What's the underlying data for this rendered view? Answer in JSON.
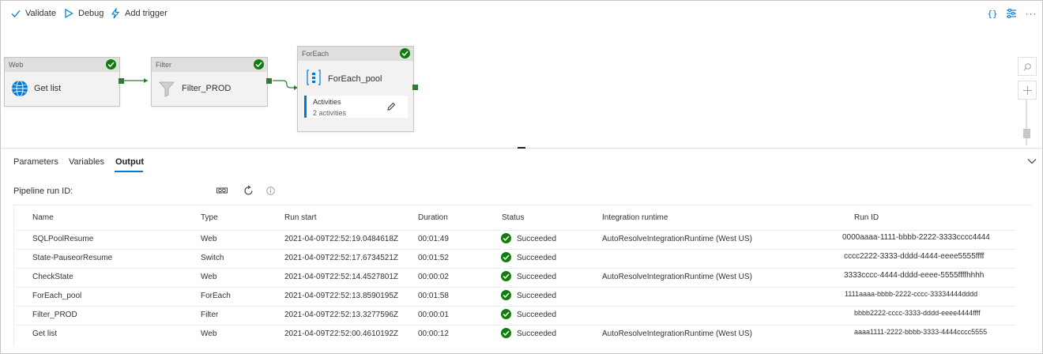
{
  "toolbar": {
    "validate_label": "Validate",
    "debug_label": "Debug",
    "add_trigger_label": "Add trigger",
    "right_icons": [
      "code-braces-icon",
      "properties-icon",
      "more-icon"
    ]
  },
  "canvas": {
    "nodes": [
      {
        "type": "Web",
        "label": "Get list",
        "icon": "globe-icon"
      },
      {
        "type": "Filter",
        "label": "Filter_PROD",
        "icon": "filter-icon"
      },
      {
        "type": "ForEach",
        "label": "ForEach_pool",
        "icon": "foreach-icon",
        "activities_title": "Activities",
        "activities_count": "2 activities"
      }
    ],
    "accent_color": "#0078d4",
    "success_color": "#107c10"
  },
  "tabs": [
    {
      "label": "Parameters"
    },
    {
      "label": "Variables"
    },
    {
      "label": "Output",
      "active": true
    }
  ],
  "output": {
    "run_id_label": "Pipeline run ID:",
    "columns": [
      "Name",
      "Type",
      "Run start",
      "Duration",
      "Status",
      "Integration runtime",
      "Run ID"
    ],
    "rows": [
      {
        "name": "SQLPoolResume",
        "type": "Web",
        "run_start": "2021-04-09T22:52:19.0484618Z",
        "duration": "00:01:49",
        "status": "Succeeded",
        "runtime": "AutoResolveIntegrationRuntime (West US)",
        "run_id": "0000aaaa-1111-bbbb-2222-3333cccc4444"
      },
      {
        "name": "State-PauseorResume",
        "type": "Switch",
        "run_start": "2021-04-09T22:52:17.6734521Z",
        "duration": "00:01:52",
        "status": "Succeeded",
        "runtime": "",
        "run_id": "cccc2222-3333-dddd-4444-eeee5555ffff"
      },
      {
        "name": "CheckState",
        "type": "Web",
        "run_start": "2021-04-09T22:52:14.4527801Z",
        "duration": "00:00:02",
        "status": "Succeeded",
        "runtime": "AutoResolveIntegrationRuntime (West US)",
        "run_id": "3333cccc-4444-dddd-eeee-5555ffffhhhh"
      },
      {
        "name": "ForEach_pool",
        "type": "ForEach",
        "run_start": "2021-04-09T22:52:13.8590195Z",
        "duration": "00:01:58",
        "status": "Succeeded",
        "runtime": "",
        "run_id": "1111aaaa-bbbb-2222-cccc-33334444dddd"
      },
      {
        "name": "Filter_PROD",
        "type": "Filter",
        "run_start": "2021-04-09T22:52:13.3277596Z",
        "duration": "00:00:01",
        "status": "Succeeded",
        "runtime": "",
        "run_id": "bbbb2222-cccc-3333-dddd-eeee4444ffff"
      },
      {
        "name": "Get list",
        "type": "Web",
        "run_start": "2021-04-09T22:52:00.4610192Z",
        "duration": "00:00:12",
        "status": "Succeeded",
        "runtime": "AutoResolveIntegrationRuntime (West US)",
        "run_id": "aaaa1111-2222-bbbb-3333-4444cccc5555"
      }
    ]
  }
}
